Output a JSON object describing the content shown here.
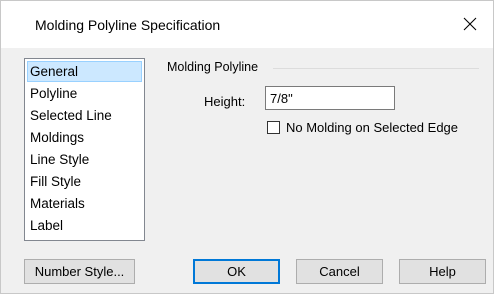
{
  "window": {
    "title": "Molding Polyline Specification"
  },
  "nav": {
    "items": [
      {
        "label": "General",
        "selected": true
      },
      {
        "label": "Polyline",
        "selected": false
      },
      {
        "label": "Selected Line",
        "selected": false
      },
      {
        "label": "Moldings",
        "selected": false
      },
      {
        "label": "Line Style",
        "selected": false
      },
      {
        "label": "Fill Style",
        "selected": false
      },
      {
        "label": "Materials",
        "selected": false
      },
      {
        "label": "Label",
        "selected": false
      }
    ]
  },
  "panel": {
    "group_label": "Molding Polyline",
    "height_label": "Height:",
    "height_value": "7/8\"",
    "no_molding_label": "No Molding on Selected Edge",
    "no_molding_checked": false
  },
  "buttons": {
    "number_style": "Number Style...",
    "ok": "OK",
    "cancel": "Cancel",
    "help": "Help"
  },
  "colors": {
    "selection_bg": "#cce8ff",
    "selection_border": "#99d1ff",
    "default_button_border": "#0078d7",
    "dialog_bg": "#f0f0f0"
  }
}
